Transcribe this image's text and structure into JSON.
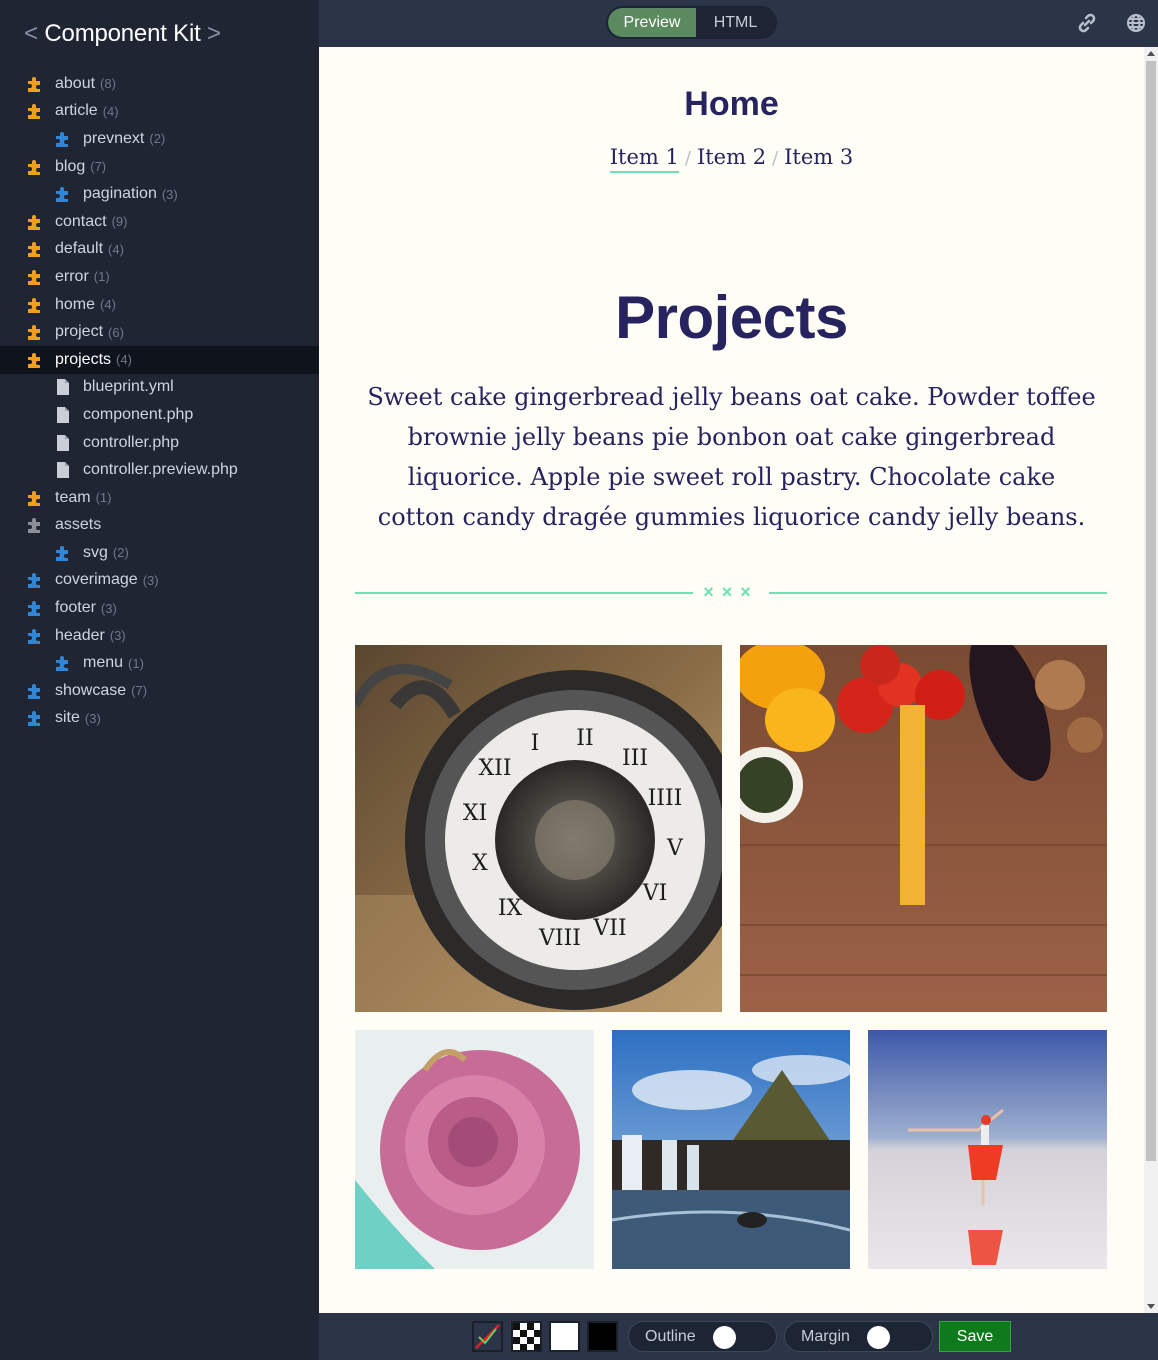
{
  "app": {
    "title": "Component Kit",
    "title_prefix": "<",
    "title_suffix": ">"
  },
  "sidebar": {
    "items": [
      {
        "label": "about",
        "count": "(8)",
        "icon": "puzzle-orange",
        "level": 0
      },
      {
        "label": "article",
        "count": "(4)",
        "icon": "puzzle-orange",
        "level": 0
      },
      {
        "label": "prevnext",
        "count": "(2)",
        "icon": "puzzle-blue",
        "level": 1
      },
      {
        "label": "blog",
        "count": "(7)",
        "icon": "puzzle-orange",
        "level": 0
      },
      {
        "label": "pagination",
        "count": "(3)",
        "icon": "puzzle-blue",
        "level": 1
      },
      {
        "label": "contact",
        "count": "(9)",
        "icon": "puzzle-orange",
        "level": 0
      },
      {
        "label": "default",
        "count": "(4)",
        "icon": "puzzle-orange",
        "level": 0
      },
      {
        "label": "error",
        "count": "(1)",
        "icon": "puzzle-orange",
        "level": 0
      },
      {
        "label": "home",
        "count": "(4)",
        "icon": "puzzle-orange",
        "level": 0
      },
      {
        "label": "project",
        "count": "(6)",
        "icon": "puzzle-orange",
        "level": 0
      },
      {
        "label": "projects",
        "count": "(4)",
        "icon": "puzzle-orange",
        "level": 0,
        "selected": true
      },
      {
        "label": "blueprint.yml",
        "count": "",
        "icon": "file-gray",
        "level": 1
      },
      {
        "label": "component.php",
        "count": "",
        "icon": "file-gray",
        "level": 1
      },
      {
        "label": "controller.php",
        "count": "",
        "icon": "file-gray",
        "level": 1
      },
      {
        "label": "controller.preview.php",
        "count": "",
        "icon": "file-gray",
        "level": 1
      },
      {
        "label": "team",
        "count": "(1)",
        "icon": "puzzle-orange",
        "level": 0
      },
      {
        "label": "assets",
        "count": "",
        "icon": "puzzle-gray",
        "level": 0
      },
      {
        "label": "svg",
        "count": "(2)",
        "icon": "puzzle-blue",
        "level": 1
      },
      {
        "label": "coverimage",
        "count": "(3)",
        "icon": "puzzle-blue",
        "level": 0
      },
      {
        "label": "footer",
        "count": "(3)",
        "icon": "puzzle-blue",
        "level": 0
      },
      {
        "label": "header",
        "count": "(3)",
        "icon": "puzzle-blue",
        "level": 0
      },
      {
        "label": "menu",
        "count": "(1)",
        "icon": "puzzle-blue",
        "level": 1
      },
      {
        "label": "showcase",
        "count": "(7)",
        "icon": "puzzle-blue",
        "level": 0
      },
      {
        "label": "site",
        "count": "(3)",
        "icon": "puzzle-blue",
        "level": 0
      }
    ]
  },
  "toolbar": {
    "preview_label": "Preview",
    "html_label": "HTML",
    "link_icon": "link-icon",
    "globe_icon": "globe-icon"
  },
  "preview": {
    "home_title": "Home",
    "breadcrumb": [
      "Item 1",
      "Item 2",
      "Item 3"
    ],
    "breadcrumb_sep": "/",
    "projects_title": "Projects",
    "projects_text": "Sweet cake gingerbread jelly beans oat cake. Powder toffee brownie jelly beans pie bonbon oat cake gingerbread liquorice. Apple pie sweet roll pastry. Chocolate cake cotton candy dragée gummies liquorice candy jelly beans.",
    "divider_marks": "×××",
    "images": [
      "pocket-watch",
      "vegetables",
      "pink-rose",
      "waterfall-mountain",
      "dancer-reflection"
    ]
  },
  "bottombar": {
    "outline_label": "Outline",
    "margin_label": "Margin",
    "save_label": "Save"
  },
  "colors": {
    "accent_green": "#6fe0b4",
    "title_navy": "#27235e",
    "orange_icon": "#f0a01e",
    "blue_icon": "#2f86d6",
    "save_green": "#0f7a1b"
  }
}
